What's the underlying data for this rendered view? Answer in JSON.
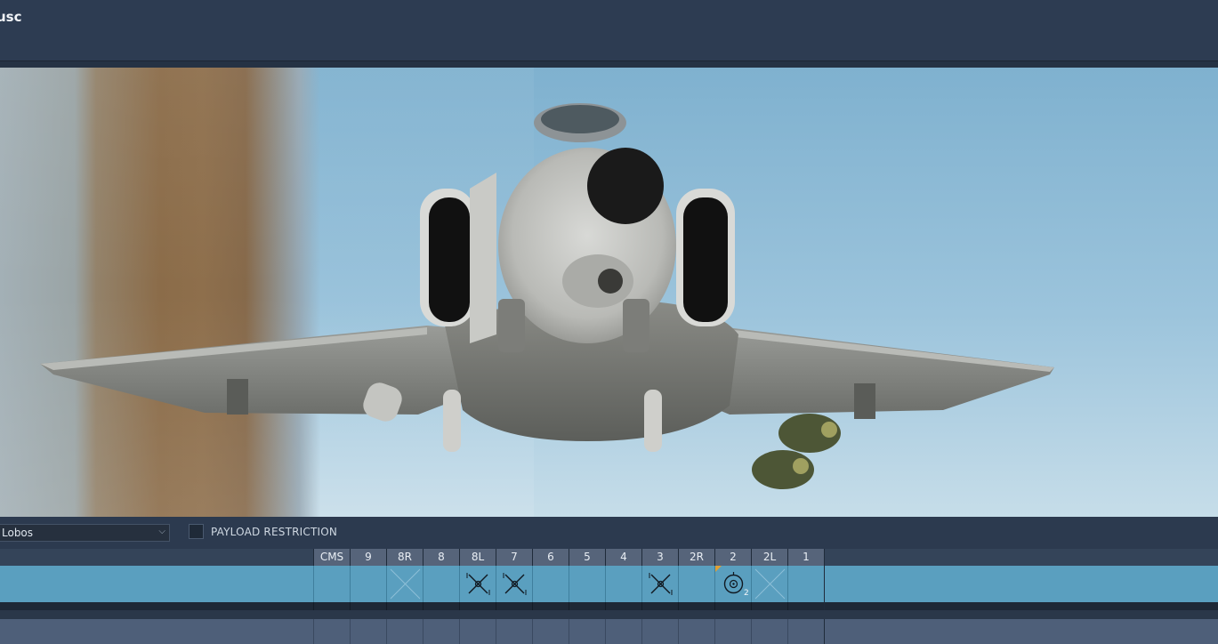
{
  "window": {
    "title": "usc"
  },
  "loadout": {
    "selected": "Lobos",
    "restriction_label": "PAYLOAD RESTRICTION",
    "restriction_checked": false
  },
  "stations": [
    {
      "label": "CMS",
      "icon": null
    },
    {
      "label": "9",
      "icon": null
    },
    {
      "label": "8R",
      "icon": "empty-x-icon"
    },
    {
      "label": "8",
      "icon": null
    },
    {
      "label": "8L",
      "icon": "missile-x-icon"
    },
    {
      "label": "7",
      "icon": "missile-x-icon"
    },
    {
      "label": "6",
      "icon": null
    },
    {
      "label": "5",
      "icon": null
    },
    {
      "label": "4",
      "icon": null
    },
    {
      "label": "3",
      "icon": "missile-x-icon"
    },
    {
      "label": "2R",
      "icon": null
    },
    {
      "label": "2",
      "icon": "bomb-circle-icon",
      "count": "2",
      "marker": true
    },
    {
      "label": "2L",
      "icon": "empty-x-icon"
    },
    {
      "label": "1",
      "icon": null
    }
  ],
  "colors": {
    "accent_row": "#5a9fbf",
    "header": "#56647a",
    "marker": "#e0a035"
  }
}
